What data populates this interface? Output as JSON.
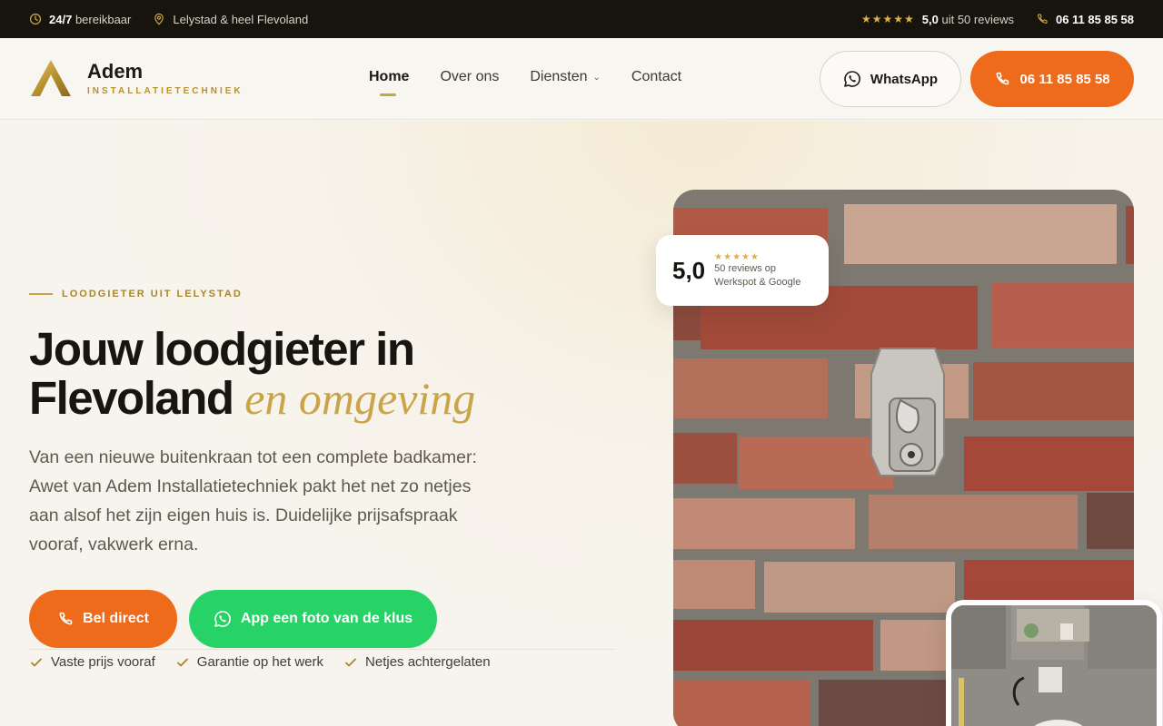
{
  "topbar": {
    "availability_bold": "24/7",
    "availability_rest": "bereikbaar",
    "location": "Lelystad & heel Flevoland",
    "rating_stars": "★★★★★",
    "rating_score": "5,0",
    "rating_rest": "uit 50 reviews",
    "phone": "06 11 85 85 58"
  },
  "header": {
    "logo_name": "Adem",
    "logo_sub": "INSTALLATIETECHNIEK",
    "nav": [
      {
        "label": "Home"
      },
      {
        "label": "Over ons"
      },
      {
        "label": "Diensten"
      },
      {
        "label": "Contact"
      }
    ],
    "whatsapp_label": "WhatsApp",
    "call_label": "06 11 85 85 58"
  },
  "hero": {
    "eyebrow": "LOODGIETER UIT LELYSTAD",
    "title_line1": "Jouw loodgieter in",
    "title_line2_main": "Flevoland",
    "title_line2_accent": "en omgeving",
    "lead": "Van een nieuwe buitenkraan tot een complete badkamer: Awet van Adem Installatietechniek pakt het net zo netjes aan alsof het zijn eigen huis is. Duidelijke prijsafspraak vooraf, vakwerk erna.",
    "btn_call": "Bel direct",
    "btn_app": "App een foto van de klus",
    "checks": [
      "Vaste prijs vooraf",
      "Garantie op het werk",
      "Netjes achtergelaten"
    ]
  },
  "review_card": {
    "score": "5,0",
    "stars": "★★★★★",
    "line1": "50 reviews op",
    "line2": "Werkspot & Google"
  },
  "colors": {
    "accent_orange": "#ee6b1b",
    "accent_gold": "#c9a24a",
    "whatsapp_green": "#27d366",
    "topbar_dark": "#17140d"
  }
}
